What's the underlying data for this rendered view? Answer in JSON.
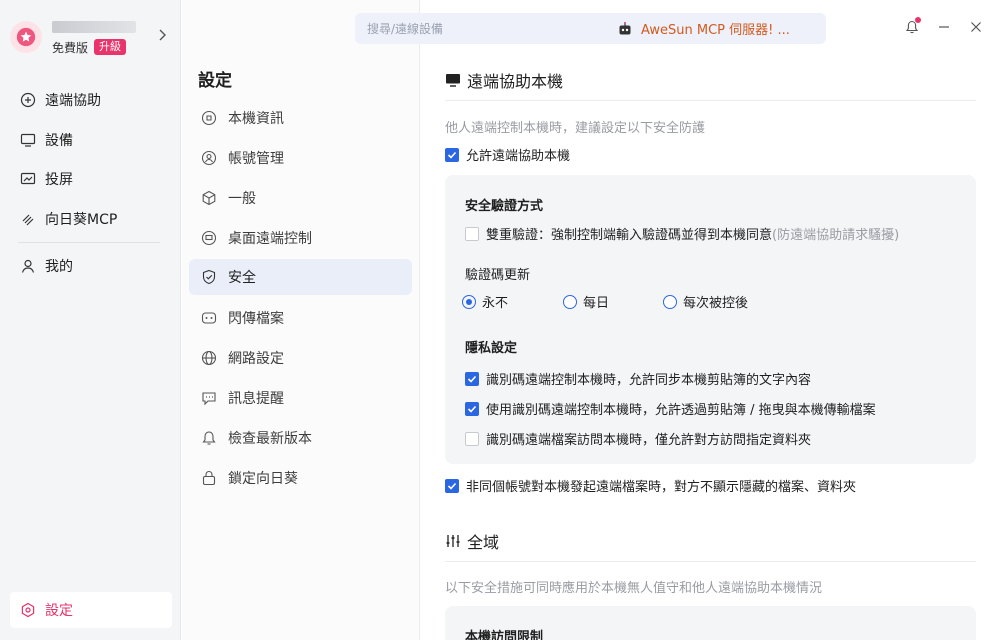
{
  "account": {
    "plan": "免費版",
    "upgrade_label": "升級"
  },
  "sidebar": {
    "items": [
      {
        "label": "遠端協助",
        "icon": "remote-assist-icon"
      },
      {
        "label": "設備",
        "icon": "monitor-icon"
      },
      {
        "label": "投屏",
        "icon": "screen-cast-icon"
      },
      {
        "label": "向日葵MCP",
        "icon": "mcp-icon"
      },
      {
        "label": "我的",
        "icon": "user-icon"
      }
    ],
    "settings_label": "設定"
  },
  "settings_menu": {
    "title": "設定",
    "items": [
      {
        "label": "本機資訊"
      },
      {
        "label": "帳號管理"
      },
      {
        "label": "一般"
      },
      {
        "label": "桌面遠端控制"
      },
      {
        "label": "安全"
      },
      {
        "label": "閃傳檔案"
      },
      {
        "label": "網路設定"
      },
      {
        "label": "訊息提醒"
      },
      {
        "label": "檢查最新版本"
      },
      {
        "label": "鎖定向日葵"
      }
    ],
    "active": "安全"
  },
  "topbar": {
    "search_placeholder": "搜尋/遠線設備",
    "promo_text": "AweSun MCP 伺服器! ..."
  },
  "content": {
    "section1": {
      "title": "遠端協助本機",
      "hint": "他人遠端控制本機時，建議設定以下安全防護",
      "allow_label": "允許遠端協助本機",
      "allow_checked": true,
      "panel": {
        "verify_title": "安全驗證方式",
        "double_verify_label": "雙重驗證：強制控制端輸入驗證碼並得到本機同意",
        "double_verify_note": "(防遠端協助請求騷擾)",
        "double_verify_checked": false,
        "code_update_label": "驗證碼更新",
        "code_update_options": [
          "永不",
          "每日",
          "每次被控後"
        ],
        "code_update_selected": "永不",
        "privacy_title": "隱私設定",
        "privacy_options": [
          {
            "label": "識別碼遠端控制本機時，允許同步本機剪貼簿的文字內容",
            "checked": true
          },
          {
            "label": "使用識別碼遠端控制本機時，允許透過剪貼簿 / 拖曳與本機傳輸檔案",
            "checked": true
          },
          {
            "label": "識別碼遠端檔案訪問本機時，僅允許對方訪問指定資料夾",
            "checked": false
          }
        ]
      },
      "hidden_files_label": "非同個帳號對本機發起遠端檔案時，對方不顯示隱藏的檔案、資料夾",
      "hidden_files_checked": true
    },
    "section2": {
      "title": "全域",
      "hint": "以下安全措施可同時應用於本機無人值守和他人遠端協助本機情況",
      "panel_title": "本機訪問限制"
    }
  },
  "colors": {
    "accent": "#2b66e3",
    "brand": "#e8336b",
    "promo": "#d25a1f"
  }
}
